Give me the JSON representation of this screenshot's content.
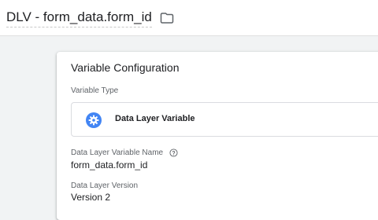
{
  "header": {
    "title": "DLV - form_data.form_id",
    "folder_icon": "folder-icon"
  },
  "card": {
    "title": "Variable Configuration",
    "variable_type_label": "Variable Type",
    "variable_type_value": "Data Layer Variable",
    "variable_type_icon": "gear-icon",
    "variable_type_icon_color": "#4285f4",
    "dlv_name_label": "Data Layer Variable Name",
    "dlv_name_value": "form_data.form_id",
    "help_icon": "help-circle-icon",
    "version_label": "Data Layer Version",
    "version_value": "Version 2"
  }
}
